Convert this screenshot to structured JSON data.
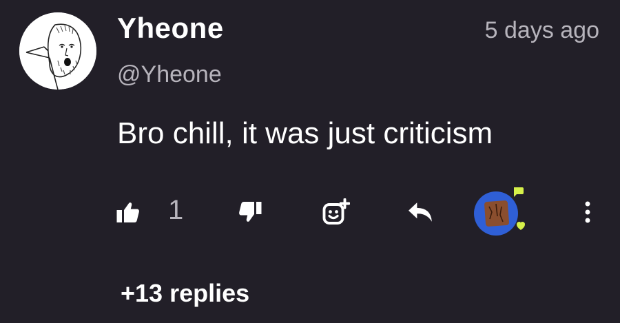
{
  "comment": {
    "username": "Yheone",
    "handle": "@Yheone",
    "timestamp": "5 days ago",
    "text": "Bro chill, it was just criticism"
  },
  "actions": {
    "like_count": "1",
    "like_icon": "thumbs-up-icon",
    "dislike_icon": "thumbs-down-icon",
    "emoji_icon": "add-reaction-icon",
    "reply_icon": "reply-arrow-icon",
    "badge_icon": "award-badge-icon",
    "more_icon": "vertical-dots-icon"
  },
  "replies_label": "+13 replies",
  "colors": {
    "background": "#221f28",
    "text_primary": "#ffffff",
    "text_secondary": "#b7b4bc",
    "badge_blue": "#2f5fd6",
    "badge_green": "#d6f04a"
  }
}
